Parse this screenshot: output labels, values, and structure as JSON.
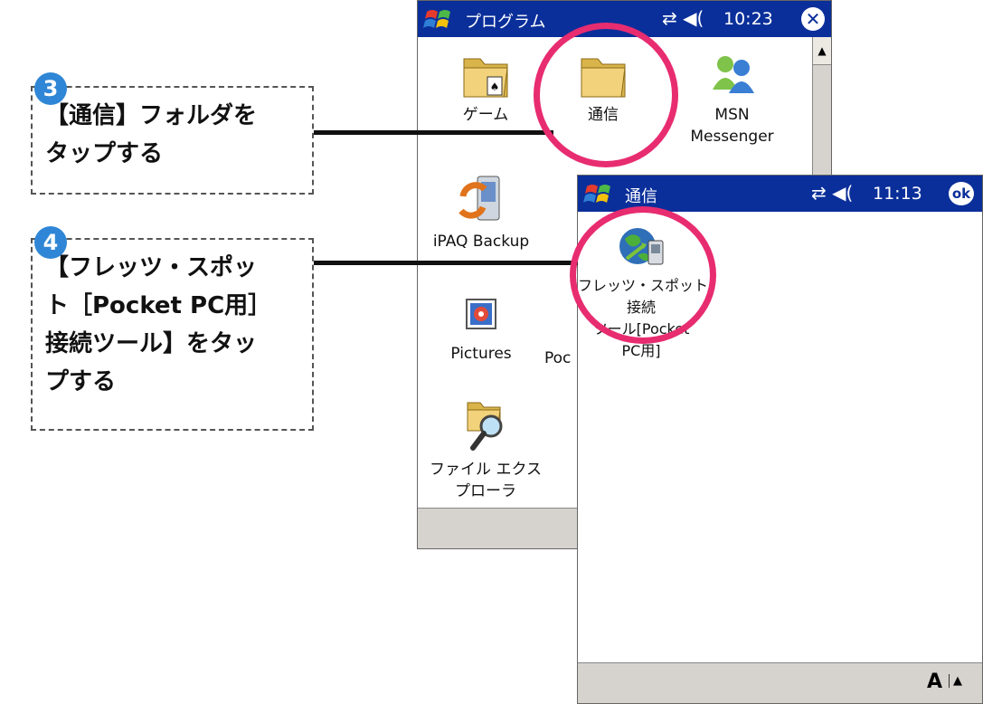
{
  "steps": [
    {
      "number": "3",
      "lines": [
        "【通信】フォルダを",
        "タップする"
      ]
    },
    {
      "number": "4",
      "lines": [
        "【フレッツ・スポッ",
        "ト［Pocket PC用］",
        "接続ツール】をタッ",
        "プする"
      ]
    }
  ],
  "programs_window": {
    "title": "プログラム",
    "time": "10:23",
    "status_icons": "⇄ ◀(",
    "close_icon": "close-icon",
    "apps": [
      {
        "label": "ゲーム",
        "icon": "games-folder-icon"
      },
      {
        "label": "通信",
        "icon": "folder-icon"
      },
      {
        "label_line1": "MSN",
        "label_line2": "Messenger",
        "icon": "msn-messenger-icon"
      },
      {
        "label": "iPAQ Backup",
        "icon": "ipaq-backup-icon"
      },
      {
        "label": "Pictures",
        "icon": "pictures-icon"
      },
      {
        "label": "Poc",
        "icon": ""
      },
      {
        "label_line1": "ファイル エクス",
        "label_line2": "プローラ",
        "icon": "file-explorer-icon"
      }
    ]
  },
  "comm_window": {
    "title": "通信",
    "time": "11:13",
    "status_icons": "⇄ ◀(",
    "ok_label": "ok",
    "app": {
      "line1": "フレッツ・スポット",
      "line2": "接続",
      "line3": "ツール[Pocket",
      "line4": "PC用]",
      "icon": "globe-connection-icon"
    },
    "softbar_input": "A",
    "softbar_arrow": "▲"
  },
  "colors": {
    "title_bar": "#0a2f9a",
    "highlight_ring": "#e82c70",
    "badge": "#2f86d6",
    "softbar": "#d6d3ce"
  }
}
